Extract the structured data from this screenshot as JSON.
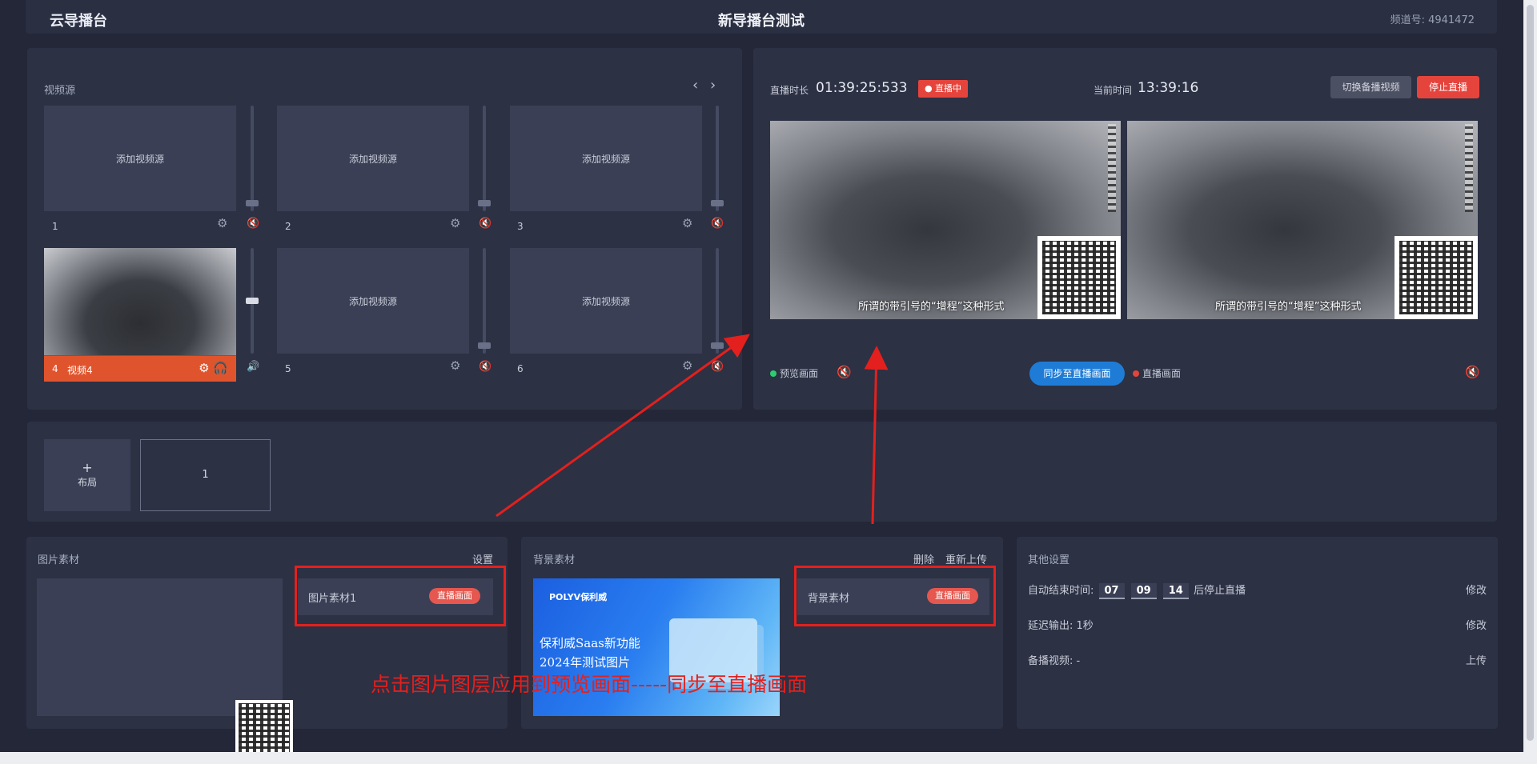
{
  "header": {
    "app_title": "云导播台",
    "page_title": "新导播台测试",
    "channel": "频道号: 4941472"
  },
  "sources": {
    "title": "视频源",
    "prev_icon": "‹",
    "next_icon": "›",
    "placeholder": "添加视频源",
    "items": [
      {
        "num": "1",
        "placeholder": "添加视频源",
        "level": 0.05
      },
      {
        "num": "2",
        "placeholder": "添加视频源",
        "level": 0.05
      },
      {
        "num": "3",
        "placeholder": "添加视频源",
        "level": 0.05
      },
      {
        "num": "4",
        "name": "视频4",
        "active": true,
        "level": 0.5
      },
      {
        "num": "5",
        "placeholder": "添加视频源",
        "level": 0.05
      },
      {
        "num": "6",
        "placeholder": "添加视频源",
        "level": 0.05
      }
    ]
  },
  "monitor": {
    "duration_label": "直播时长",
    "duration_value": "01:39:25:533",
    "live_badge": "直播中",
    "time_label": "当前时间",
    "time_value": "13:39:16",
    "switch_btn": "切换备播视频",
    "stop_btn": "停止直播",
    "preview_label": "预览画面",
    "live_label": "直播画面",
    "sync_btn": "同步至直播画面",
    "caption": "所谓的带引号的“增程”这种形式",
    "colors": {
      "preview_dot": "#2ecc71",
      "live_dot": "#e5443c",
      "accent": "#1f7cd6",
      "danger": "#e5443c"
    }
  },
  "layouts": {
    "add_label": "布局",
    "add_icon": "+",
    "items": [
      "1"
    ]
  },
  "image_materials": {
    "title": "图片素材",
    "settings": "设置",
    "row_name": "图片素材1",
    "row_tag": "直播画面"
  },
  "bg_materials": {
    "title": "背景素材",
    "delete": "删除",
    "reupload": "重新上传",
    "row_name": "背景素材",
    "row_tag": "直播画面",
    "preview_brand": "POLYV保利威",
    "preview_line1": "保利威Saas新功能",
    "preview_line2": "2024年测试图片"
  },
  "other_settings": {
    "title": "其他设置",
    "auto_end_label": "自动结束时间:",
    "auto_end_h": "07",
    "auto_end_m": "09",
    "auto_end_s": "14",
    "auto_end_suffix": "后停止直播",
    "edit1": "修改",
    "delay_label": "延迟输出: 1秒",
    "edit2": "修改",
    "backup_label": "备播视频: -",
    "upload": "上传"
  },
  "annotation": {
    "text": "点击图片图层应用到预览画面-----同步至直播画面",
    "color": "#e3201d"
  }
}
